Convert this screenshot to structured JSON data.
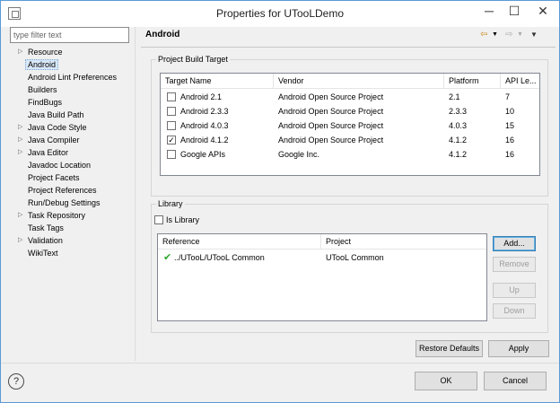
{
  "window": {
    "title": "Properties for UTooLDemo",
    "icons": {
      "app": "properties-window-icon",
      "minimize": "─",
      "maximize": "☐",
      "close": "✕"
    }
  },
  "sidebar": {
    "filter_placeholder": "type filter text",
    "items": [
      {
        "label": "Resource",
        "expandable": true
      },
      {
        "label": "Android",
        "expandable": false,
        "selected": true
      },
      {
        "label": "Android Lint Preferences",
        "expandable": false
      },
      {
        "label": "Builders",
        "expandable": false
      },
      {
        "label": "FindBugs",
        "expandable": false
      },
      {
        "label": "Java Build Path",
        "expandable": false
      },
      {
        "label": "Java Code Style",
        "expandable": true
      },
      {
        "label": "Java Compiler",
        "expandable": true
      },
      {
        "label": "Java Editor",
        "expandable": true
      },
      {
        "label": "Javadoc Location",
        "expandable": false
      },
      {
        "label": "Project Facets",
        "expandable": false
      },
      {
        "label": "Project References",
        "expandable": false
      },
      {
        "label": "Run/Debug Settings",
        "expandable": false
      },
      {
        "label": "Task Repository",
        "expandable": true
      },
      {
        "label": "Task Tags",
        "expandable": false
      },
      {
        "label": "Validation",
        "expandable": true
      },
      {
        "label": "WikiText",
        "expandable": false
      }
    ]
  },
  "page": {
    "title": "Android",
    "nav_icons": [
      "back-arrow-icon",
      "dropdown-icon",
      "forward-arrow-icon",
      "dropdown-icon",
      "view-menu-icon"
    ]
  },
  "build_target": {
    "legend": "Project Build Target",
    "columns": [
      "Target Name",
      "Vendor",
      "Platform",
      "API Le..."
    ],
    "rows": [
      {
        "name": "Android 2.1",
        "vendor": "Android Open Source Project",
        "platform": "2.1",
        "api": "7",
        "checked": false
      },
      {
        "name": "Android 2.3.3",
        "vendor": "Android Open Source Project",
        "platform": "2.3.3",
        "api": "10",
        "checked": false
      },
      {
        "name": "Android 4.0.3",
        "vendor": "Android Open Source Project",
        "platform": "4.0.3",
        "api": "15",
        "checked": false
      },
      {
        "name": "Android 4.1.2",
        "vendor": "Android Open Source Project",
        "platform": "4.1.2",
        "api": "16",
        "checked": true
      },
      {
        "name": "Google APIs",
        "vendor": "Google Inc.",
        "platform": "4.1.2",
        "api": "16",
        "checked": false
      }
    ]
  },
  "library": {
    "legend": "Library",
    "is_library_label": "Is Library",
    "is_library_checked": false,
    "columns": [
      "Reference",
      "Project"
    ],
    "rows": [
      {
        "reference": "../UTooL/UTooL Common",
        "project": "UTooL Common",
        "status": "ok"
      }
    ],
    "buttons": {
      "add": "Add...",
      "remove": "Remove",
      "up": "Up",
      "down": "Down"
    }
  },
  "actions": {
    "restore_defaults": "Restore Defaults",
    "apply": "Apply",
    "ok": "OK",
    "cancel": "Cancel",
    "help": "?"
  },
  "colors": {
    "window_border": "#5a9bd5",
    "selection": "#d9e8f8",
    "checkmark_green": "#2ea82e",
    "dialog_bg": "#f0f0f0"
  }
}
